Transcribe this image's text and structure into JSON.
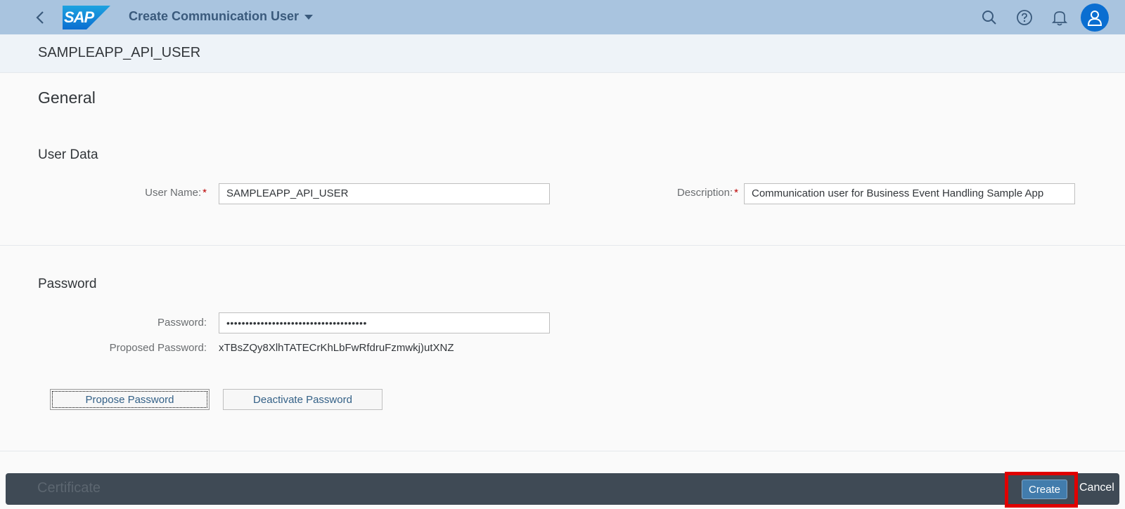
{
  "shell": {
    "logo_text": "SAP",
    "app_title": "Create Communication User"
  },
  "header": {
    "object_title": "SAMPLEAPP_API_USER"
  },
  "general": {
    "title": "General"
  },
  "user_data": {
    "title": "User Data",
    "user_name_label": "User Name:",
    "user_name_value": "SAMPLEAPP_API_USER",
    "description_label": "Description:",
    "description_value": "Communication user for Business Event Handling Sample App",
    "required_marker": "*"
  },
  "password": {
    "title": "Password",
    "password_label": "Password:",
    "password_value": "•••••••••••••••••••••••••••••••••••••",
    "proposed_label": "Proposed Password:",
    "proposed_value": "xTBsZQy8XlhTATECrKhLbFwRfdruFzmwkj)utXNZ",
    "propose_button": "Propose Password",
    "deactivate_button": "Deactivate Password"
  },
  "certificate": {
    "title": "Certificate"
  },
  "footer": {
    "create_label": "Create",
    "cancel_label": "Cancel"
  },
  "colors": {
    "shell_bg": "#a9c4df",
    "accent": "#0a6ed1",
    "footer_bg": "#3f4a55",
    "highlight": "#e00000"
  }
}
